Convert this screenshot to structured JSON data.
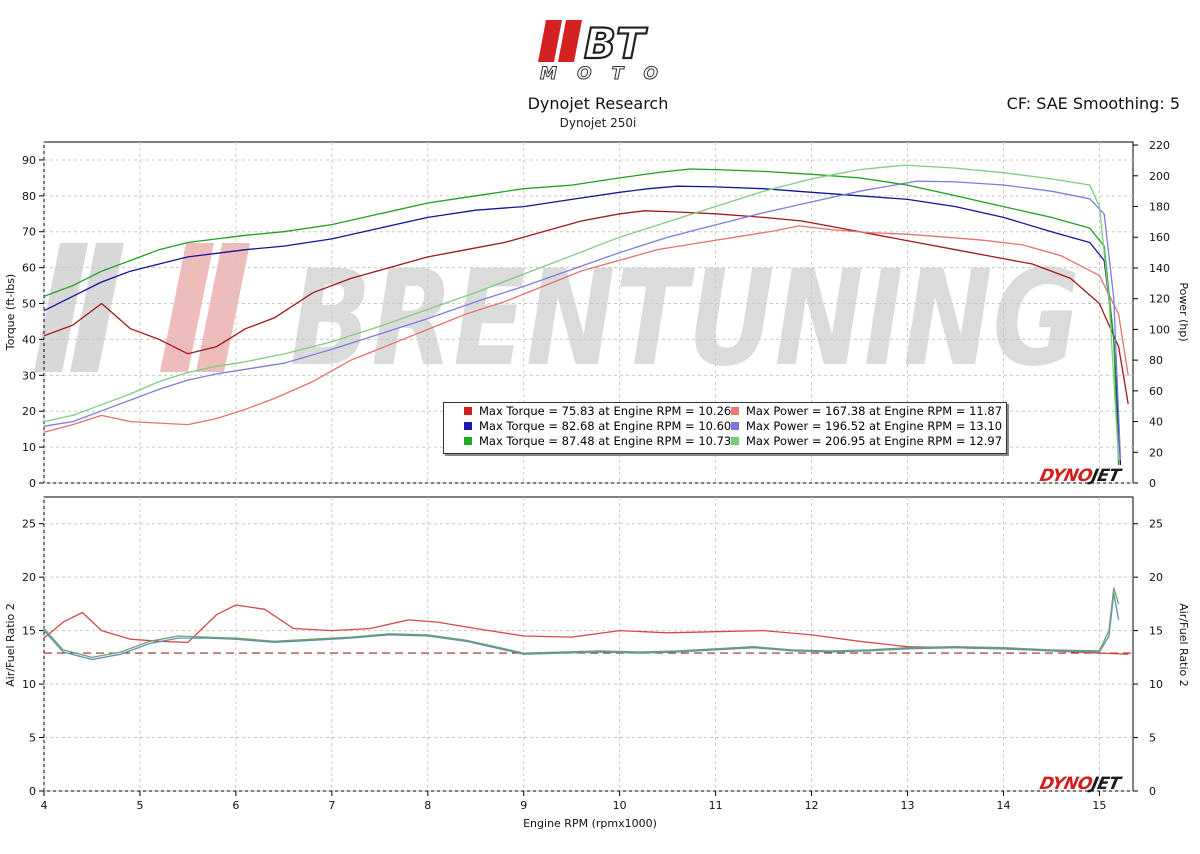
{
  "header": {
    "logo_text_top": "BT",
    "logo_text_bottom": "MOTO",
    "title": "Dynojet Research",
    "subtitle": "Dynojet 250i",
    "cf_text": "CF: SAE Smoothing: 5"
  },
  "watermark_text": "BRENTUNING",
  "dyno_brand": [
    "DYNO",
    "JET"
  ],
  "chart_data": [
    {
      "type": "line",
      "xlabel": "Engine RPM (rpmx1000)",
      "ylabel": "Torque (ft-lbs)",
      "ylabel_right": "Power (hp)",
      "xlim": [
        4,
        15.35
      ],
      "ylim": [
        0,
        95
      ],
      "ylim_right": [
        0,
        222
      ],
      "x_ticks": [
        4,
        5,
        6,
        7,
        8,
        9,
        10,
        11,
        12,
        13,
        14,
        15
      ],
      "y_ticks": [
        0,
        10,
        20,
        30,
        40,
        50,
        60,
        70,
        80,
        90
      ],
      "y_ticks_right": [
        0,
        20,
        40,
        60,
        80,
        100,
        120,
        140,
        160,
        180,
        200,
        220
      ],
      "grid": true,
      "legend_position": "bottom-right",
      "legend": [
        {
          "text": "Max Torque = 75.83 at Engine RPM = 10.26",
          "color": "#d42020"
        },
        {
          "text": "Max Power = 167.38 at Engine RPM = 11.87",
          "color": "#ee7777"
        },
        {
          "text": "Max Torque = 82.68 at Engine RPM = 10.60",
          "color": "#1a1ab0"
        },
        {
          "text": "Max Power = 196.52 at Engine RPM = 13.10",
          "color": "#7777dd"
        },
        {
          "text": "Max Torque = 87.48 at Engine RPM = 10.73",
          "color": "#22aa22"
        },
        {
          "text": "Max Power = 206.95 at Engine RPM = 12.97",
          "color": "#77cc77"
        }
      ],
      "series": [
        {
          "color": "#a01818",
          "axis": "left",
          "x": [
            4.0,
            4.3,
            4.6,
            4.9,
            5.2,
            5.5,
            5.8,
            6.1,
            6.4,
            6.8,
            7.2,
            7.6,
            8.0,
            8.4,
            8.8,
            9.2,
            9.6,
            10.0,
            10.26,
            10.6,
            11.0,
            11.5,
            11.9,
            12.3,
            12.7,
            13.1,
            13.5,
            13.9,
            14.3,
            14.7,
            15.0,
            15.2,
            15.3
          ],
          "y": [
            41,
            44,
            50,
            43,
            40,
            36,
            38,
            43,
            46,
            53,
            57,
            60,
            63,
            65,
            67,
            70,
            73,
            75,
            75.83,
            75.5,
            75,
            74,
            73,
            71,
            69,
            67,
            65,
            63,
            61,
            57,
            50,
            38,
            22
          ]
        },
        {
          "color": "#e87070",
          "axis": "right",
          "x": [
            4.0,
            4.3,
            4.6,
            4.9,
            5.2,
            5.5,
            5.8,
            6.1,
            6.4,
            6.8,
            7.2,
            7.6,
            8.0,
            8.4,
            8.8,
            9.2,
            9.6,
            10.0,
            10.4,
            10.8,
            11.2,
            11.6,
            11.87,
            12.2,
            12.6,
            13.0,
            13.4,
            13.8,
            14.2,
            14.6,
            15.0,
            15.2,
            15.3
          ],
          "y": [
            33,
            38,
            44,
            40,
            39,
            38,
            42,
            48,
            55,
            66,
            80,
            90,
            100,
            110,
            118,
            128,
            138,
            145,
            152,
            156,
            160,
            164,
            167.38,
            165,
            163,
            162,
            160,
            158,
            155,
            148,
            135,
            110,
            70
          ]
        },
        {
          "color": "#14149a",
          "axis": "left",
          "x": [
            4.0,
            4.3,
            4.6,
            4.9,
            5.2,
            5.5,
            5.8,
            6.1,
            6.5,
            7.0,
            7.5,
            8.0,
            8.5,
            9.0,
            9.5,
            10.0,
            10.3,
            10.6,
            11.0,
            11.5,
            12.0,
            12.5,
            13.0,
            13.5,
            14.0,
            14.5,
            14.9,
            15.05,
            15.15,
            15.22
          ],
          "y": [
            48,
            52,
            56,
            59,
            61,
            63,
            64,
            65,
            66,
            68,
            71,
            74,
            76,
            77,
            79,
            81,
            82,
            82.68,
            82.5,
            82,
            81,
            80,
            79,
            77,
            74,
            70,
            67,
            62,
            40,
            5
          ]
        },
        {
          "color": "#7c7cdc",
          "axis": "right",
          "x": [
            4.0,
            4.3,
            4.6,
            4.9,
            5.2,
            5.5,
            5.8,
            6.1,
            6.5,
            7.0,
            7.5,
            8.0,
            8.5,
            9.0,
            9.5,
            10.0,
            10.5,
            11.0,
            11.5,
            12.0,
            12.5,
            13.1,
            13.5,
            14.0,
            14.5,
            14.9,
            15.05,
            15.15,
            15.22
          ],
          "y": [
            37,
            40,
            47,
            54,
            61,
            67,
            71,
            74,
            78,
            87,
            97,
            107,
            118,
            128,
            139,
            150,
            160,
            168,
            176,
            183,
            190,
            196.52,
            196,
            194,
            190,
            185,
            175,
            120,
            15
          ]
        },
        {
          "color": "#1ea01e",
          "axis": "left",
          "x": [
            4.0,
            4.3,
            4.6,
            4.9,
            5.2,
            5.5,
            5.8,
            6.1,
            6.5,
            7.0,
            7.5,
            8.0,
            8.5,
            9.0,
            9.5,
            10.0,
            10.4,
            10.73,
            11.0,
            11.5,
            12.0,
            12.5,
            13.0,
            13.5,
            14.0,
            14.5,
            14.9,
            15.05,
            15.15,
            15.2
          ],
          "y": [
            52,
            55,
            59,
            62,
            65,
            67,
            68,
            69,
            70,
            72,
            75,
            78,
            80,
            82,
            83,
            85,
            86.5,
            87.48,
            87.3,
            86.8,
            86,
            85,
            83,
            80,
            77,
            74,
            71,
            66,
            40,
            5
          ]
        },
        {
          "color": "#80cc80",
          "axis": "right",
          "x": [
            4.0,
            4.3,
            4.6,
            4.9,
            5.2,
            5.5,
            5.8,
            6.1,
            6.5,
            7.0,
            7.5,
            8.0,
            8.5,
            9.0,
            9.5,
            10.0,
            10.5,
            11.0,
            11.5,
            12.0,
            12.5,
            12.97,
            13.5,
            14.0,
            14.5,
            14.9,
            15.0,
            15.1,
            15.2
          ],
          "y": [
            40,
            44,
            51,
            58,
            66,
            72,
            76,
            79,
            84,
            92,
            102,
            113,
            124,
            136,
            148,
            160,
            170,
            180,
            190,
            198,
            204,
            206.95,
            205,
            202,
            198,
            194,
            180,
            120,
            15
          ]
        }
      ]
    },
    {
      "type": "line",
      "xlabel": "Engine RPM (rpmx1000)",
      "ylabel": "Air/Fuel Ratio 2",
      "ylabel_right": "Air/Fuel Ratio 2",
      "xlim": [
        4,
        15.35
      ],
      "ylim": [
        0,
        27.5
      ],
      "x_ticks": [
        4,
        5,
        6,
        7,
        8,
        9,
        10,
        11,
        12,
        13,
        14,
        15
      ],
      "y_ticks": [
        0,
        5,
        10,
        15,
        20,
        25
      ],
      "grid": true,
      "reference_line": {
        "y": 12.9,
        "color": "#9a2a2a",
        "style": "dashed"
      },
      "series": [
        {
          "color": "#d84848",
          "x": [
            4.0,
            4.2,
            4.4,
            4.6,
            4.9,
            5.2,
            5.5,
            5.8,
            6.0,
            6.3,
            6.6,
            7.0,
            7.4,
            7.8,
            8.1,
            8.5,
            9.0,
            9.5,
            10.0,
            10.5,
            11.0,
            11.5,
            12.0,
            12.5,
            13.0,
            13.5,
            14.0,
            14.5,
            15.0,
            15.3
          ],
          "y": [
            14.3,
            15.8,
            16.7,
            15.0,
            14.2,
            14.0,
            13.9,
            16.5,
            17.4,
            17.0,
            15.2,
            15.0,
            15.2,
            16.0,
            15.8,
            15.2,
            14.5,
            14.4,
            15.0,
            14.8,
            14.9,
            15.0,
            14.6,
            14.0,
            13.5,
            13.4,
            13.3,
            13.1,
            12.9,
            12.8
          ]
        },
        {
          "color": "#5d8fb8",
          "x": [
            4.0,
            4.2,
            4.5,
            4.8,
            5.1,
            5.4,
            5.7,
            6.0,
            6.4,
            6.8,
            7.2,
            7.6,
            8.0,
            8.4,
            8.8,
            9.0,
            9.4,
            9.8,
            10.2,
            10.6,
            11.0,
            11.4,
            11.8,
            12.2,
            12.6,
            13.0,
            13.5,
            14.0,
            14.5,
            15.0,
            15.1,
            15.15,
            15.2
          ],
          "y": [
            15.0,
            13.0,
            12.3,
            12.8,
            13.8,
            14.3,
            14.3,
            14.2,
            13.9,
            14.1,
            14.3,
            14.6,
            14.5,
            14.0,
            13.2,
            12.8,
            12.9,
            13.0,
            12.9,
            13.0,
            13.2,
            13.4,
            13.1,
            13.0,
            13.1,
            13.3,
            13.4,
            13.3,
            13.1,
            13.0,
            14.5,
            18.5,
            16.0
          ]
        },
        {
          "color": "#6e9e6e",
          "x": [
            4.0,
            4.2,
            4.5,
            4.8,
            5.1,
            5.4,
            5.7,
            6.0,
            6.4,
            6.8,
            7.2,
            7.6,
            8.0,
            8.4,
            8.8,
            9.0,
            9.4,
            9.8,
            10.2,
            10.6,
            11.0,
            11.4,
            11.8,
            12.2,
            12.6,
            13.0,
            13.5,
            14.0,
            14.5,
            15.0,
            15.1,
            15.15,
            15.2
          ],
          "y": [
            15.2,
            13.2,
            12.5,
            13.0,
            14.0,
            14.5,
            14.4,
            14.3,
            14.0,
            14.2,
            14.4,
            14.7,
            14.6,
            14.1,
            13.3,
            12.9,
            13.0,
            13.1,
            13.0,
            13.1,
            13.3,
            13.5,
            13.2,
            13.1,
            13.2,
            13.4,
            13.5,
            13.4,
            13.2,
            13.1,
            15.0,
            19.0,
            17.5
          ]
        }
      ]
    }
  ]
}
